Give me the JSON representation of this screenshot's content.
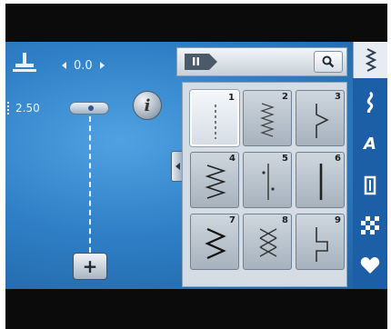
{
  "stitch_settings": {
    "needle_offset": "0.0",
    "stitch_length": "2.50"
  },
  "buttons": {
    "info_label": "i",
    "add_label": "+"
  },
  "grid_header": {
    "active_tab": "II"
  },
  "stitches": [
    {
      "number": "1",
      "pattern": "straight",
      "selected": true
    },
    {
      "number": "2",
      "pattern": "triple-straight",
      "selected": false
    },
    {
      "number": "3",
      "pattern": "blind-hem",
      "selected": false
    },
    {
      "number": "4",
      "pattern": "zigzag-wide",
      "selected": false
    },
    {
      "number": "5",
      "pattern": "straight-with-marks",
      "selected": false
    },
    {
      "number": "6",
      "pattern": "heavy-straight",
      "selected": false
    },
    {
      "number": "7",
      "pattern": "zigzag",
      "selected": false
    },
    {
      "number": "8",
      "pattern": "honeycomb",
      "selected": false
    },
    {
      "number": "9",
      "pattern": "blind-hem-step",
      "selected": false
    }
  ],
  "rail": {
    "alphabet_label": "A"
  },
  "colors": {
    "screen_blue": "#2f7fc6",
    "rail_blue": "#1d5fa6",
    "tile_gray": "#a7b2bd"
  }
}
